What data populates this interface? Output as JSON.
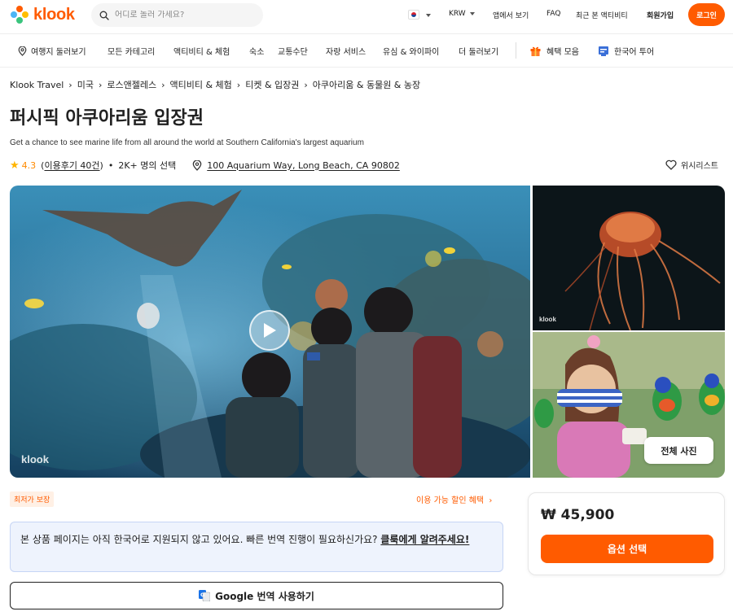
{
  "header": {
    "logo_text": "klook",
    "search_placeholder": "어디로 놀러 가세요?",
    "currency": "KRW",
    "app_link": "앱에서 보기",
    "faq": "FAQ",
    "recent": "최근 본 액티비티",
    "signup": "회원가입",
    "login": "로그인"
  },
  "nav": {
    "items": [
      "여행지 둘러보기",
      "모든 카테고리",
      "액티비티 & 체험",
      "숙소",
      "교통수단",
      "자랑 서비스",
      "유심 & 와이파이",
      "더 둘러보기"
    ],
    "promo": "혜택 모음",
    "korean_tour": "한국어 투어"
  },
  "breadcrumb": [
    "Klook Travel",
    "미국",
    "로스앤젤레스",
    "액티비티 & 체험",
    "티켓 & 입장권",
    "아쿠아리움 & 동물원 & 농장"
  ],
  "product": {
    "title": "퍼시픽 아쿠아리움 입장권",
    "subtitle": "Get a chance to see marine life from all around the world at Southern California's largest aquarium",
    "rating": "4.3",
    "reviews_prefix": "(",
    "reviews_link": "이용후기 40건",
    "reviews_suffix": ")",
    "booked": "2K+ 명의 선택",
    "address": "100 Aquarium Way, Long Beach, CA 90802",
    "wishlist": "위시리스트"
  },
  "gallery": {
    "watermark": "klook",
    "small_watermark": "klook",
    "all_photos": "전체 사진"
  },
  "lower": {
    "best_price_badge": "최저가 보장",
    "discount_link": "이용 가능 할인 혜택",
    "notice_text": "본 상품 페이지는 아직 한국어로 지원되지 않고 있어요. 빠른 번역 진행이 필요하신가요? ",
    "notice_link": "클룩에게 알려주세요!",
    "google_translate": "Google 번역 사용하기"
  },
  "price_card": {
    "price": "₩ 45,900",
    "select_option": "옵션 선택"
  },
  "colors": {
    "brand": "#ff5b00",
    "star": "#ffb400",
    "notice_bg": "#eef3fd"
  }
}
